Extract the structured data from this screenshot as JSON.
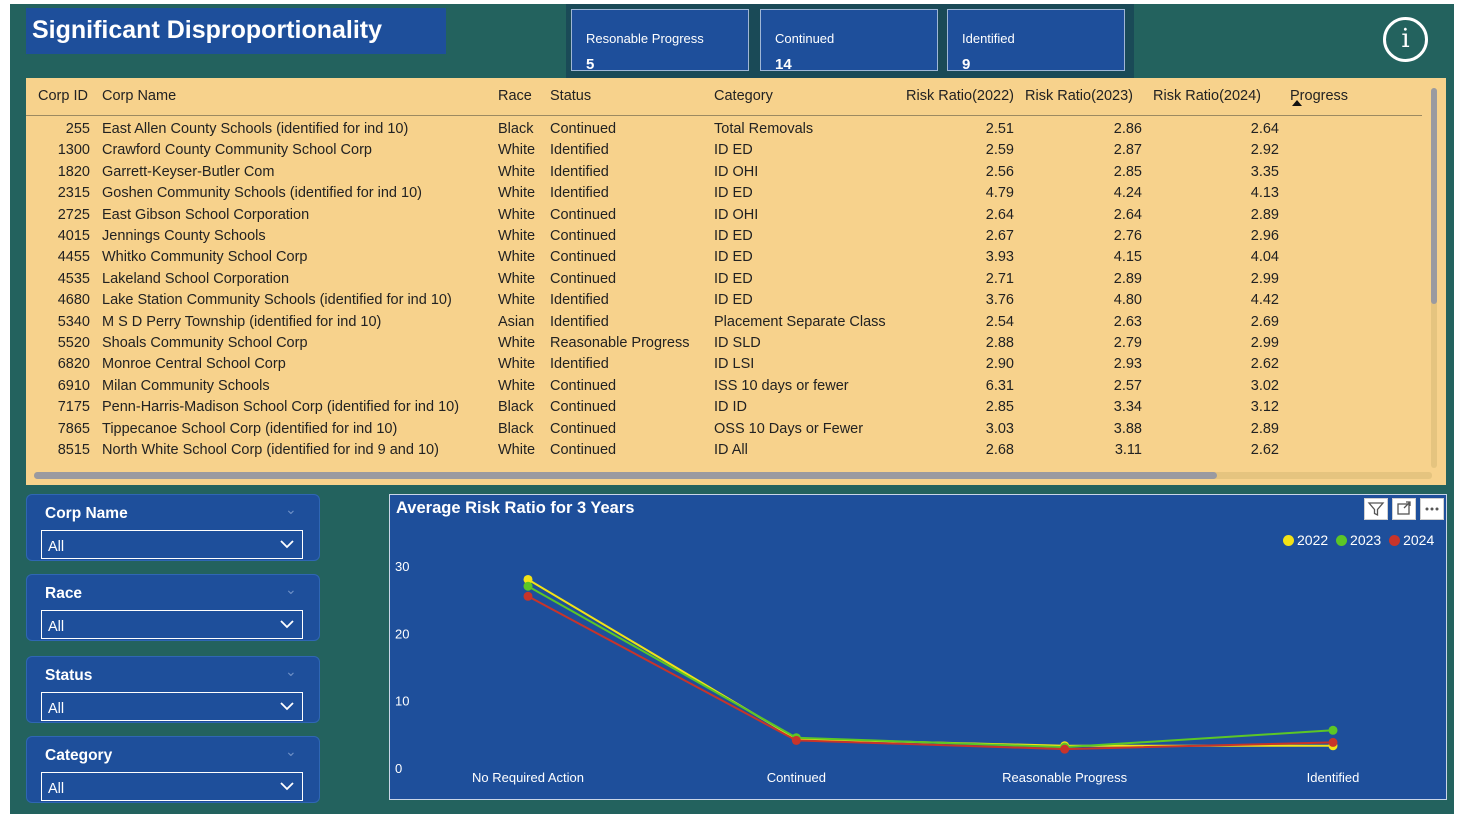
{
  "header": {
    "title": "Significant Disproportionality",
    "info_glyph": "i",
    "kpis": [
      {
        "label": "Resonable Progress",
        "value": "5"
      },
      {
        "label": "Continued",
        "value": "14"
      },
      {
        "label": "Identified",
        "value": "9"
      }
    ]
  },
  "table": {
    "columns": [
      "Corp ID",
      "Corp Name",
      "Race",
      "Status",
      "Category",
      "Risk Ratio(2022)",
      "Risk Ratio(2023)",
      "Risk Ratio(2024)",
      "Progress"
    ],
    "sorted_column": "Progress",
    "rows": [
      [
        "255",
        "East Allen County Schools (identified for ind 10)",
        "Black",
        "Continued",
        "Total Removals",
        "2.51",
        "2.86",
        "2.64",
        ""
      ],
      [
        "1300",
        "Crawford County Community School Corp",
        "White",
        "Identified",
        "ID ED",
        "2.59",
        "2.87",
        "2.92",
        ""
      ],
      [
        "1820",
        "Garrett-Keyser-Butler Com",
        "White",
        "Identified",
        "ID OHI",
        "2.56",
        "2.85",
        "3.35",
        ""
      ],
      [
        "2315",
        "Goshen Community Schools (identified for ind 10)",
        "White",
        "Identified",
        "ID ED",
        "4.79",
        "4.24",
        "4.13",
        ""
      ],
      [
        "2725",
        "East Gibson School Corporation",
        "White",
        "Continued",
        "ID OHI",
        "2.64",
        "2.64",
        "2.89",
        ""
      ],
      [
        "4015",
        "Jennings County Schools",
        "White",
        "Continued",
        "ID ED",
        "2.67",
        "2.76",
        "2.96",
        ""
      ],
      [
        "4455",
        "Whitko Community School Corp",
        "White",
        "Continued",
        "ID ED",
        "3.93",
        "4.15",
        "4.04",
        ""
      ],
      [
        "4535",
        "Lakeland School Corporation",
        "White",
        "Continued",
        "ID ED",
        "2.71",
        "2.89",
        "2.99",
        ""
      ],
      [
        "4680",
        "Lake Station Community Schools (identified for ind 10)",
        "White",
        "Identified",
        "ID ED",
        "3.76",
        "4.80",
        "4.42",
        ""
      ],
      [
        "5340",
        "M S D Perry Township (identified for ind 10)",
        "Asian",
        "Identified",
        "Placement Separate Class",
        "2.54",
        "2.63",
        "2.69",
        ""
      ],
      [
        "5520",
        "Shoals Community School Corp",
        "White",
        "Reasonable Progress",
        "ID SLD",
        "2.88",
        "2.79",
        "2.99",
        ""
      ],
      [
        "6820",
        "Monroe Central School Corp",
        "White",
        "Identified",
        "ID LSI",
        "2.90",
        "2.93",
        "2.62",
        ""
      ],
      [
        "6910",
        "Milan Community Schools",
        "White",
        "Continued",
        "ISS 10 days or fewer",
        "6.31",
        "2.57",
        "3.02",
        ""
      ],
      [
        "7175",
        "Penn-Harris-Madison School Corp (identified for ind 10)",
        "Black",
        "Continued",
        "ID ID",
        "2.85",
        "3.34",
        "3.12",
        ""
      ],
      [
        "7865",
        "Tippecanoe School Corp (identified for ind 10)",
        "Black",
        "Continued",
        "OSS 10 Days or Fewer",
        "3.03",
        "3.88",
        "2.89",
        ""
      ],
      [
        "8515",
        "North White School Corp (identified for ind 9 and 10)",
        "White",
        "Continued",
        "ID All",
        "2.68",
        "3.11",
        "2.62",
        ""
      ]
    ]
  },
  "slicers": [
    {
      "title": "Corp Name",
      "value": "All"
    },
    {
      "title": "Race",
      "value": "All"
    },
    {
      "title": "Status",
      "value": "All"
    },
    {
      "title": "Category",
      "value": "All"
    }
  ],
  "chart_data": {
    "type": "line",
    "title": "Average Risk Ratio for 3 Years",
    "categories": [
      "No Required Action",
      "Continued",
      "Reasonable Progress",
      "Identified"
    ],
    "ylim": [
      0,
      30
    ],
    "yticks": [
      0,
      10,
      20,
      30
    ],
    "legend_position": "top-right",
    "grid": false,
    "series": [
      {
        "name": "2022",
        "color": "#f2e216",
        "values": [
          28.0,
          4.3,
          3.3,
          3.3
        ]
      },
      {
        "name": "2023",
        "color": "#5cc626",
        "values": [
          27.0,
          4.5,
          3.1,
          5.6
        ]
      },
      {
        "name": "2024",
        "color": "#c8342a",
        "values": [
          25.5,
          4.1,
          2.8,
          3.8
        ]
      }
    ]
  },
  "icons": {
    "info": "info-icon",
    "filter": "filter-icon",
    "focus": "focus-mode-icon",
    "more": "more-options-icon",
    "dropdown": "chevron-down-icon"
  }
}
